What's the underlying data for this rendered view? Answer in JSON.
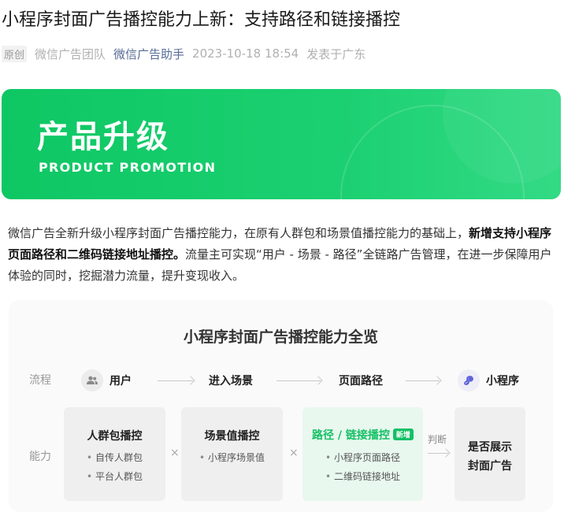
{
  "article": {
    "title": "小程序封面广告播控能力上新：支持路径和链接播控",
    "original_tag": "原创",
    "team": "微信广告团队",
    "account": "微信广告助手",
    "datetime": "2023-10-18 18:54",
    "location": "发表于广东"
  },
  "banner": {
    "cn_title": "产品升级",
    "en_title": "PRODUCT PROMOTION",
    "color_start": "#0ec763",
    "color_end": "#33da85"
  },
  "paragraph": {
    "part1": "微信广告全新升级小程序封面广告播控能力，在原有人群包和场景值播控能力的基础上，",
    "bold": "新增支持小程序页面路径和二维码链接地址播控。",
    "part2": "流量主可实现“用户 - 场景 - 路径”全链路广告管理，在进一步保障用户体验的同时，挖掘潜力流量，提升变现收入。"
  },
  "diagram": {
    "title": "小程序封面广告播控能力全览",
    "row_flow": "流程",
    "row_ability": "能力",
    "flow": {
      "user": "用户",
      "scene": "进入场景",
      "path": "页面路径",
      "miniprogram": "小程序"
    },
    "boxes": {
      "crowd": {
        "title": "人群包播控",
        "items": [
          "自传人群包",
          "平台人群包"
        ]
      },
      "scene": {
        "title": "场景值播控",
        "items": [
          "小程序场景值"
        ]
      },
      "path": {
        "title": "路径 / 链接播控",
        "badge": "新增",
        "items": [
          "小程序页面路径",
          "二维码链接地址"
        ]
      },
      "result": {
        "line1": "是否展示",
        "line2": "封面广告"
      }
    },
    "times_symbol": "×",
    "judge_label": "判断",
    "accent_green": "#15c065"
  }
}
